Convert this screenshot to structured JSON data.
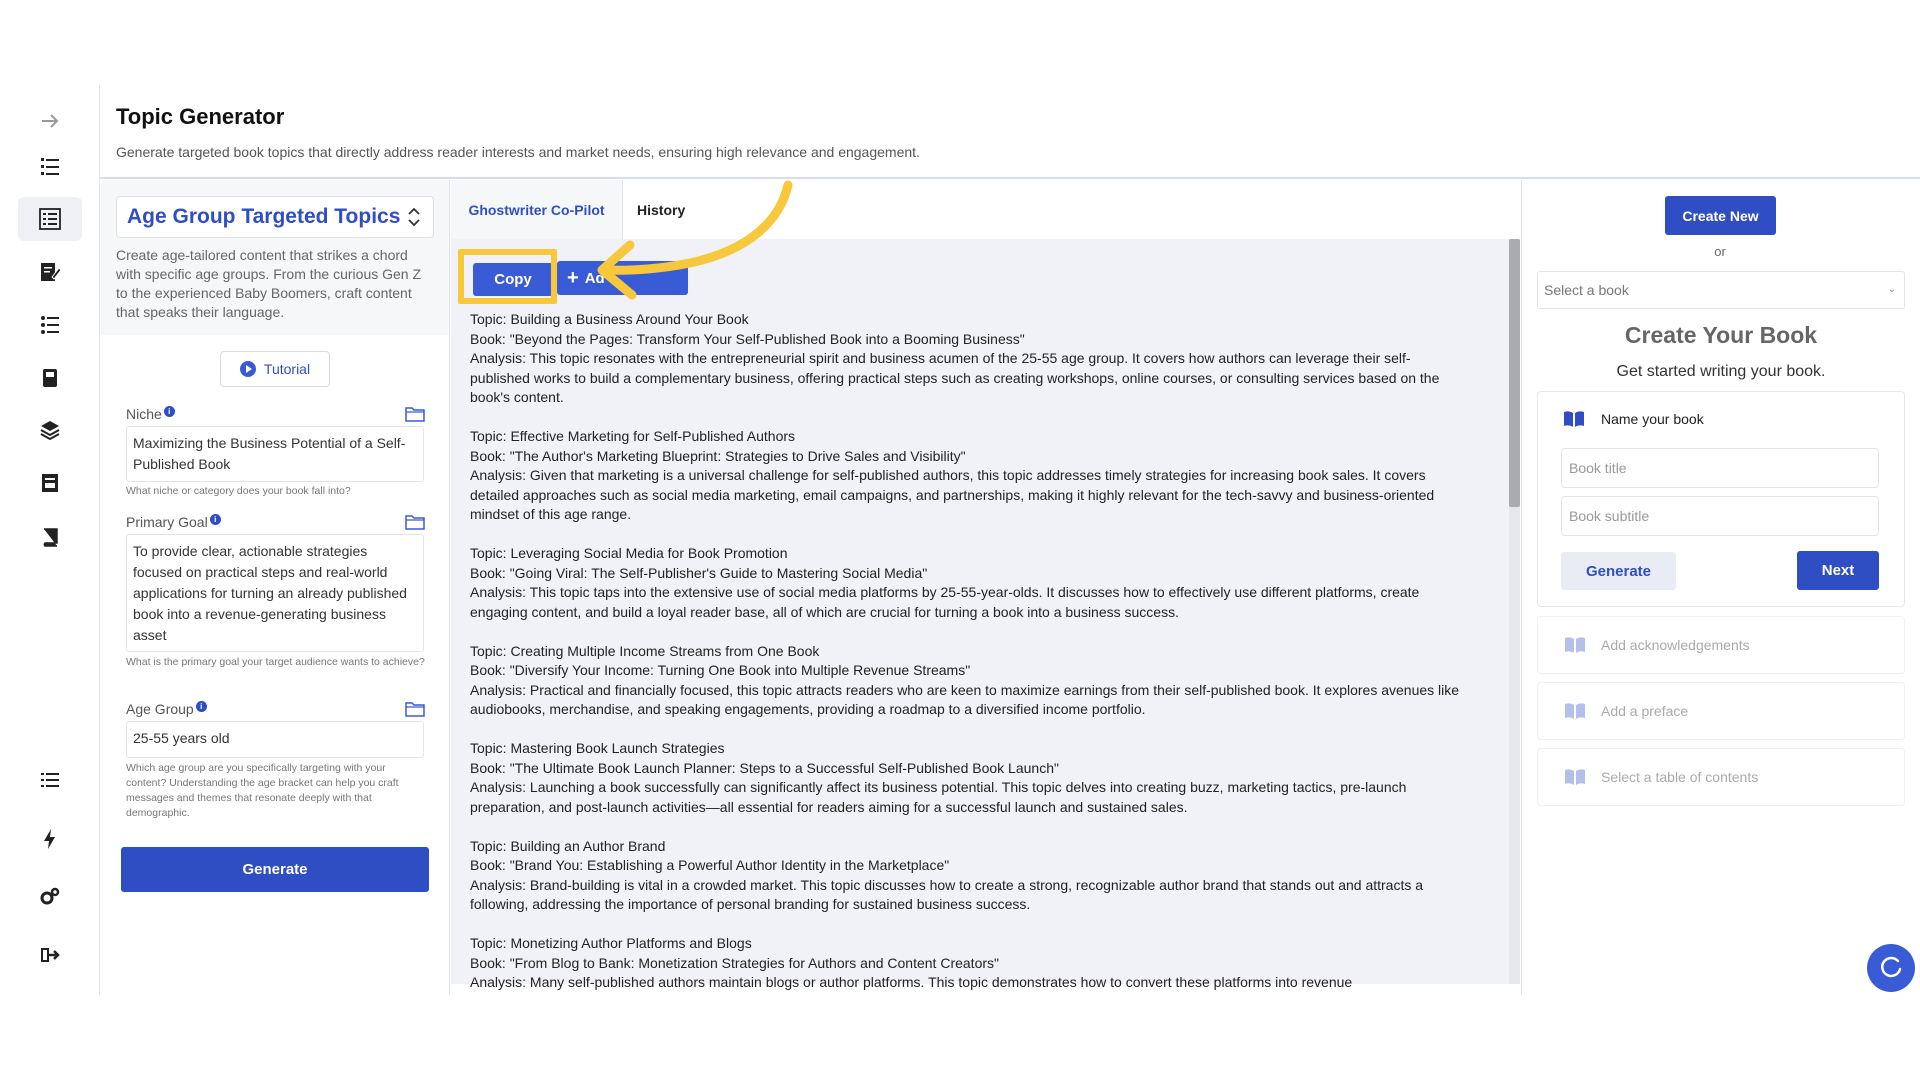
{
  "colors": {
    "accent": "#2f4ec4",
    "highlight": "#f7c83b",
    "panel_bg": "#f1f2f7"
  },
  "rail": {
    "icons": [
      "arrow-right-icon",
      "list-numbered-icon",
      "topic-list-icon",
      "edit-doc-icon",
      "outline-list-icon",
      "book-stack-icon",
      "layers-icon",
      "archive-icon",
      "book-icon",
      "menu-list-icon",
      "lightning-icon",
      "settings-icon",
      "logout-icon"
    ]
  },
  "header": {
    "title": "Topic Generator",
    "subtitle": "Generate targeted book topics that directly address reader interests and market needs, ensuring high relevance and engagement."
  },
  "form": {
    "tool_selector": "Age Group Targeted Topics",
    "description": "Create age-tailored content that strikes a chord with specific age groups. From the curious Gen Z to the experienced Baby Boomers, craft content that speaks their language.",
    "tutorial_label": "Tutorial",
    "niche": {
      "label": "Niche",
      "value": "Maximizing the Business Potential of a Self-Published Book",
      "help": "What niche or category does your book fall into?"
    },
    "goal": {
      "label": "Primary Goal",
      "value": "To provide clear, actionable strategies focused on practical steps and real-world applications for turning an already published book into a revenue-generating business asset",
      "help": "What is the primary goal your target audience wants to achieve?"
    },
    "age": {
      "label": "Age Group",
      "value": "25-55 years old",
      "help": "Which age group are you specifically targeting with your content? Understanding the age bracket can help you craft messages and themes that resonate deeply with that demographic."
    },
    "generate_label": "Generate"
  },
  "center": {
    "tabs": [
      "Ghostwriter Co-Pilot",
      "History"
    ],
    "copy_label": "Copy",
    "add_label": "Ad",
    "results": [
      {
        "topic": "Topic: Building a Business Around Your Book",
        "book": "Book: \"Beyond the Pages: Transform Your Self-Published Book into a Booming Business\"",
        "analysis": "Analysis: This topic resonates with the entrepreneurial spirit and business acumen of the 25-55 age group. It covers how authors can leverage their self-published works to build a complementary business, offering practical steps such as creating workshops, online courses, or consulting services based on the book's content."
      },
      {
        "topic": "Topic: Effective Marketing for Self-Published Authors",
        "book": "Book: \"The Author's Marketing Blueprint: Strategies to Drive Sales and Visibility\"",
        "analysis": "Analysis: Given that marketing is a universal challenge for self-published authors, this topic addresses timely strategies for increasing book sales. It covers detailed approaches such as social media marketing, email campaigns, and partnerships, making it highly relevant for the tech-savvy and business-oriented mindset of this age range."
      },
      {
        "topic": "Topic: Leveraging Social Media for Book Promotion",
        "book": "Book: \"Going Viral: The Self-Publisher's Guide to Mastering Social Media\"",
        "analysis": "Analysis: This topic taps into the extensive use of social media platforms by 25-55-year-olds. It discusses how to effectively use different platforms, create engaging content, and build a loyal reader base, all of which are crucial for turning a book into a business success."
      },
      {
        "topic": "Topic: Creating Multiple Income Streams from One Book",
        "book": "Book: \"Diversify Your Income: Turning One Book into Multiple Revenue Streams\"",
        "analysis": "Analysis: Practical and financially focused, this topic attracts readers who are keen to maximize earnings from their self-published book. It explores avenues like audiobooks, merchandise, and speaking engagements, providing a roadmap to a diversified income portfolio."
      },
      {
        "topic": "Topic: Mastering Book Launch Strategies",
        "book": "Book: \"The Ultimate Book Launch Planner: Steps to a Successful Self-Published Book Launch\"",
        "analysis": "Analysis: Launching a book successfully can significantly affect its business potential. This topic delves into creating buzz, marketing tactics, pre-launch preparation, and post-launch activities—all essential for readers aiming for a successful launch and sustained sales."
      },
      {
        "topic": "Topic: Building an Author Brand",
        "book": "Book: \"Brand You: Establishing a Powerful Author Identity in the Marketplace\"",
        "analysis": "Analysis: Brand-building is vital in a crowded market. This topic discusses how to create a strong, recognizable author brand that stands out and attracts a following, addressing the importance of personal branding for sustained business success."
      },
      {
        "topic": "Topic: Monetizing Author Platforms and Blogs",
        "book": "Book: \"From Blog to Bank: Monetization Strategies for Authors and Content Creators\"",
        "analysis": "Analysis: Many self-published authors maintain blogs or author platforms. This topic demonstrates how to convert these platforms into revenue"
      }
    ]
  },
  "right": {
    "create_new": "Create New",
    "or": "or",
    "select_placeholder": "Select a book",
    "title": "Create Your Book",
    "subtitle": "Get started writing your book.",
    "name_step": "Name your book",
    "title_placeholder": "Book title",
    "subtitle_placeholder": "Book subtitle",
    "generate_label": "Generate",
    "next_label": "Next",
    "steps": [
      "Add acknowledgements",
      "Add a preface",
      "Select a table of contents"
    ]
  }
}
